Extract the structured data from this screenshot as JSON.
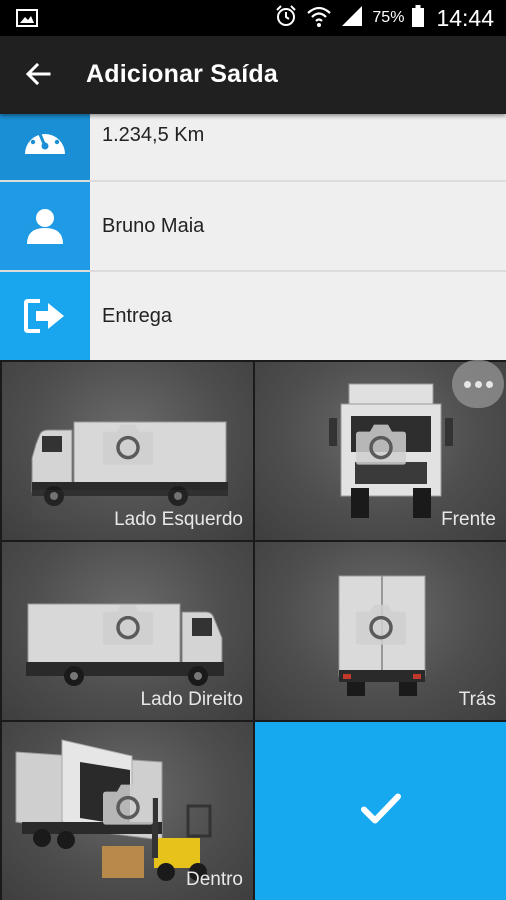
{
  "status_bar": {
    "battery_percent": "75%",
    "time": "14:44",
    "icons": [
      "image-icon",
      "alarm-icon",
      "wifi-icon",
      "signal-icon",
      "battery-icon"
    ]
  },
  "app_bar": {
    "title": "Adicionar Saída",
    "back_icon": "arrow-back-icon"
  },
  "info_rows": [
    {
      "icon": "speedometer-icon",
      "text": "1.234,5 Km"
    },
    {
      "icon": "person-icon",
      "text": "Bruno Maia"
    },
    {
      "icon": "exit-icon",
      "text": "Entrega"
    }
  ],
  "photo_tiles": [
    {
      "label": "Lado Esquerdo",
      "icon": "camera-icon"
    },
    {
      "label": "Frente",
      "icon": "camera-icon"
    },
    {
      "label": "Lado Direito",
      "icon": "camera-icon"
    },
    {
      "label": "Trás",
      "icon": "camera-icon"
    },
    {
      "label": "Dentro",
      "icon": "camera-icon"
    }
  ],
  "confirm_icon": "checkmark-icon",
  "more_icon": "more-horizontal-icon",
  "colors": {
    "app_bar": "#202020",
    "accent_blue": "#17a9f0",
    "row_background": "#efefef"
  }
}
